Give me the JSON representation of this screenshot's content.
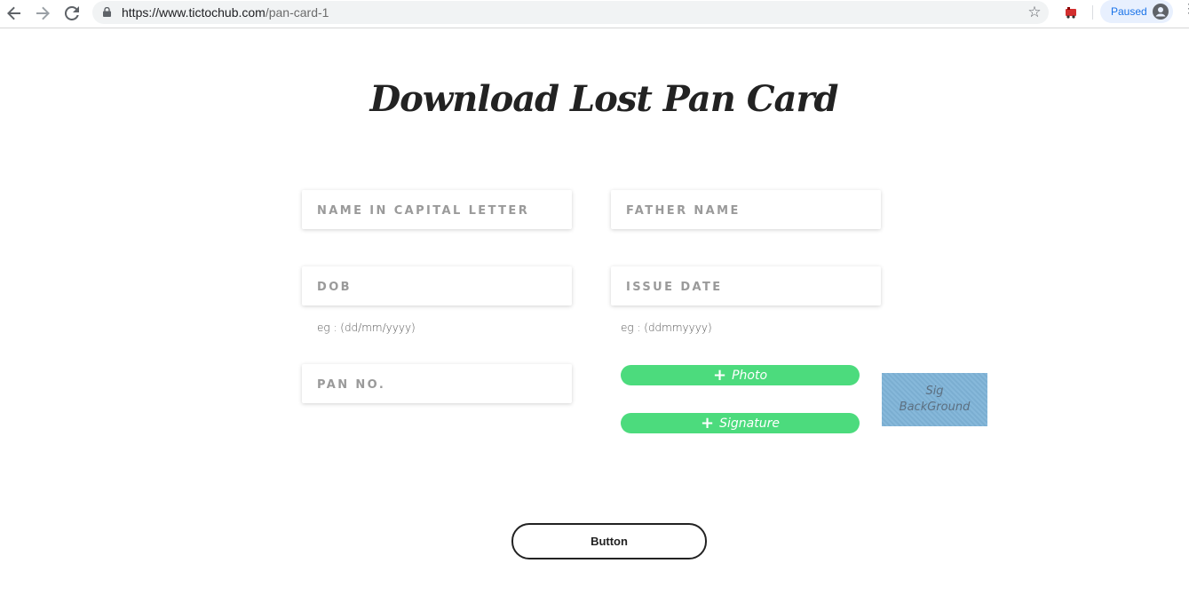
{
  "browser": {
    "url_host": "https://www.tictochub.com",
    "url_path": "/pan-card-1",
    "profile_status": "Paused",
    "icons": {
      "back": "back-arrow-icon",
      "forward": "forward-arrow-icon",
      "reload": "reload-icon",
      "lock": "lock-icon",
      "bookmark": "star-icon",
      "extension": "extension-icon",
      "profile": "avatar-icon",
      "menu": "kebab-menu-icon"
    }
  },
  "page": {
    "title": "Download Lost Pan Card",
    "fields": {
      "name": {
        "placeholder": "NAME IN CAPITAL LETTER"
      },
      "father": {
        "placeholder": "FATHER NAME"
      },
      "dob": {
        "placeholder": "DOB",
        "hint": "eg : (dd/mm/yyyy)"
      },
      "issue": {
        "placeholder": "ISSUE DATE",
        "hint": "eg : (ddmmyyyy)"
      },
      "pan": {
        "placeholder": "PAN NO."
      }
    },
    "uploads": {
      "photo_label": "Photo",
      "signature_label": "Signature",
      "plus_glyph": "+"
    },
    "signature_preview": {
      "line1": "Sig",
      "line2": "BackGround",
      "color": "#7fb4d8"
    },
    "submit_label": "Button",
    "accent_color": "#4cdb7d"
  }
}
